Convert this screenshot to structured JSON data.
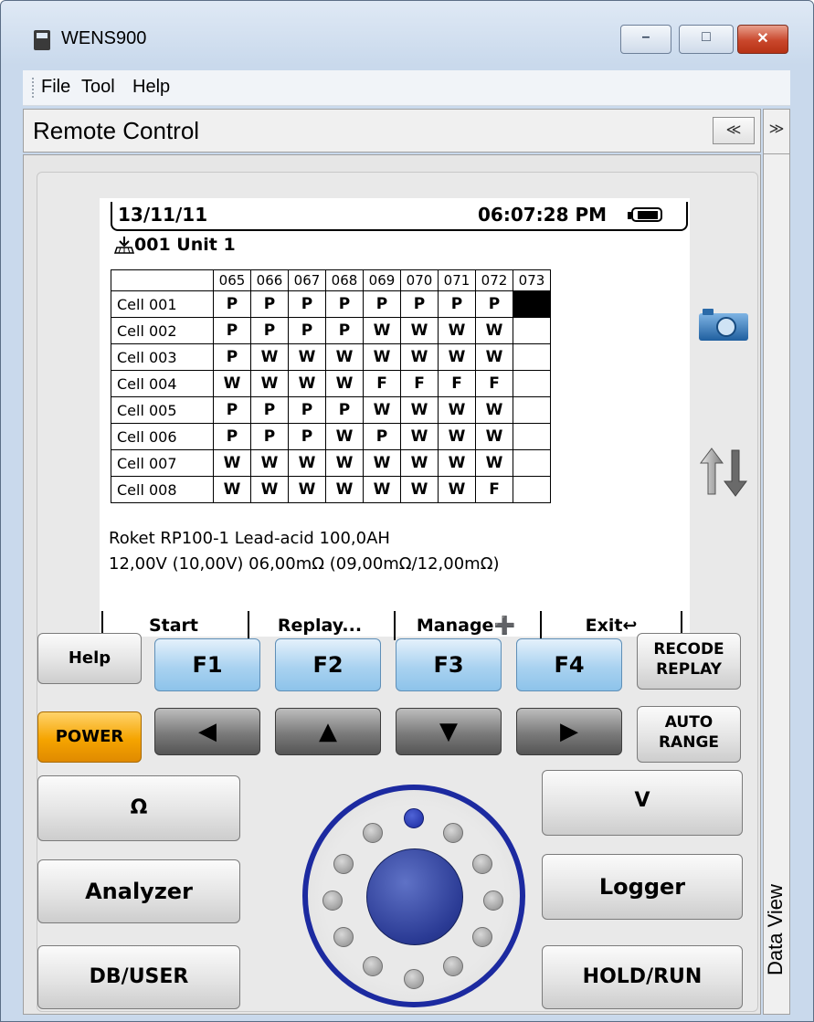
{
  "window": {
    "title": "WENS900",
    "controls": {
      "minimize": "–",
      "maximize": "□",
      "close": "✕"
    }
  },
  "menu": [
    "File",
    "Tool",
    "Help"
  ],
  "remote_control": {
    "title": "Remote Control",
    "collapse_glyph": "≪",
    "expand_glyph": "≫"
  },
  "side_panel": {
    "label": "Data View"
  },
  "lcd": {
    "date": "13/11/11",
    "time": "06:07:28 PM",
    "unit": "001 Unit  1",
    "columns": [
      "065",
      "066",
      "067",
      "068",
      "069",
      "070",
      "071",
      "072",
      "073"
    ],
    "rows": [
      {
        "label": "Cell  001",
        "values": [
          "P",
          "P",
          "P",
          "P",
          "P",
          "P",
          "P",
          "P",
          "#"
        ]
      },
      {
        "label": "Cell  002",
        "values": [
          "P",
          "P",
          "P",
          "P",
          "W",
          "W",
          "W",
          "W",
          ""
        ]
      },
      {
        "label": "Cell  003",
        "values": [
          "P",
          "W",
          "W",
          "W",
          "W",
          "W",
          "W",
          "W",
          ""
        ]
      },
      {
        "label": "Cell  004",
        "values": [
          "W",
          "W",
          "W",
          "W",
          "F",
          "F",
          "F",
          "F",
          ""
        ]
      },
      {
        "label": "Cell  005",
        "values": [
          "P",
          "P",
          "P",
          "P",
          "W",
          "W",
          "W",
          "W",
          ""
        ]
      },
      {
        "label": "Cell  006",
        "values": [
          "P",
          "P",
          "P",
          "W",
          "P",
          "W",
          "W",
          "W",
          ""
        ]
      },
      {
        "label": "Cell  007",
        "values": [
          "W",
          "W",
          "W",
          "W",
          "W",
          "W",
          "W",
          "W",
          ""
        ]
      },
      {
        "label": "Cell  008",
        "values": [
          "W",
          "W",
          "W",
          "W",
          "W",
          "W",
          "W",
          "F",
          ""
        ]
      }
    ],
    "info_line1": "Roket RP100-1  Lead-acid  100,0AH",
    "info_line2": "12,00V  (10,00V)    06,00mΩ  (09,00mΩ/12,00mΩ)",
    "softkeys": [
      "Start",
      "Replay...",
      "Manage➕",
      "Exit↩"
    ]
  },
  "icons": {
    "camera": "camera-icon",
    "transfer": "up-down-arrows-icon"
  },
  "buttons": {
    "help": "Help",
    "f1": "F1",
    "f2": "F2",
    "f3": "F3",
    "f4": "F4",
    "recode_replay_1": "RECODE",
    "recode_replay_2": "REPLAY",
    "power": "POWER",
    "left": "◀",
    "up": "▲",
    "down": "▼",
    "right": "▶",
    "auto_range_1": "AUTO",
    "auto_range_2": "RANGE",
    "ohm": "Ω",
    "volt": "V",
    "analyzer": "Analyzer",
    "logger": "Logger",
    "db_user": "DB/USER",
    "hold_run": "HOLD/RUN"
  },
  "colors": {
    "f_keys": "#a9d2f0",
    "power": "#f5a400",
    "wheel_ring": "#1c2aa0",
    "wheel_center": "#2a3a94"
  }
}
